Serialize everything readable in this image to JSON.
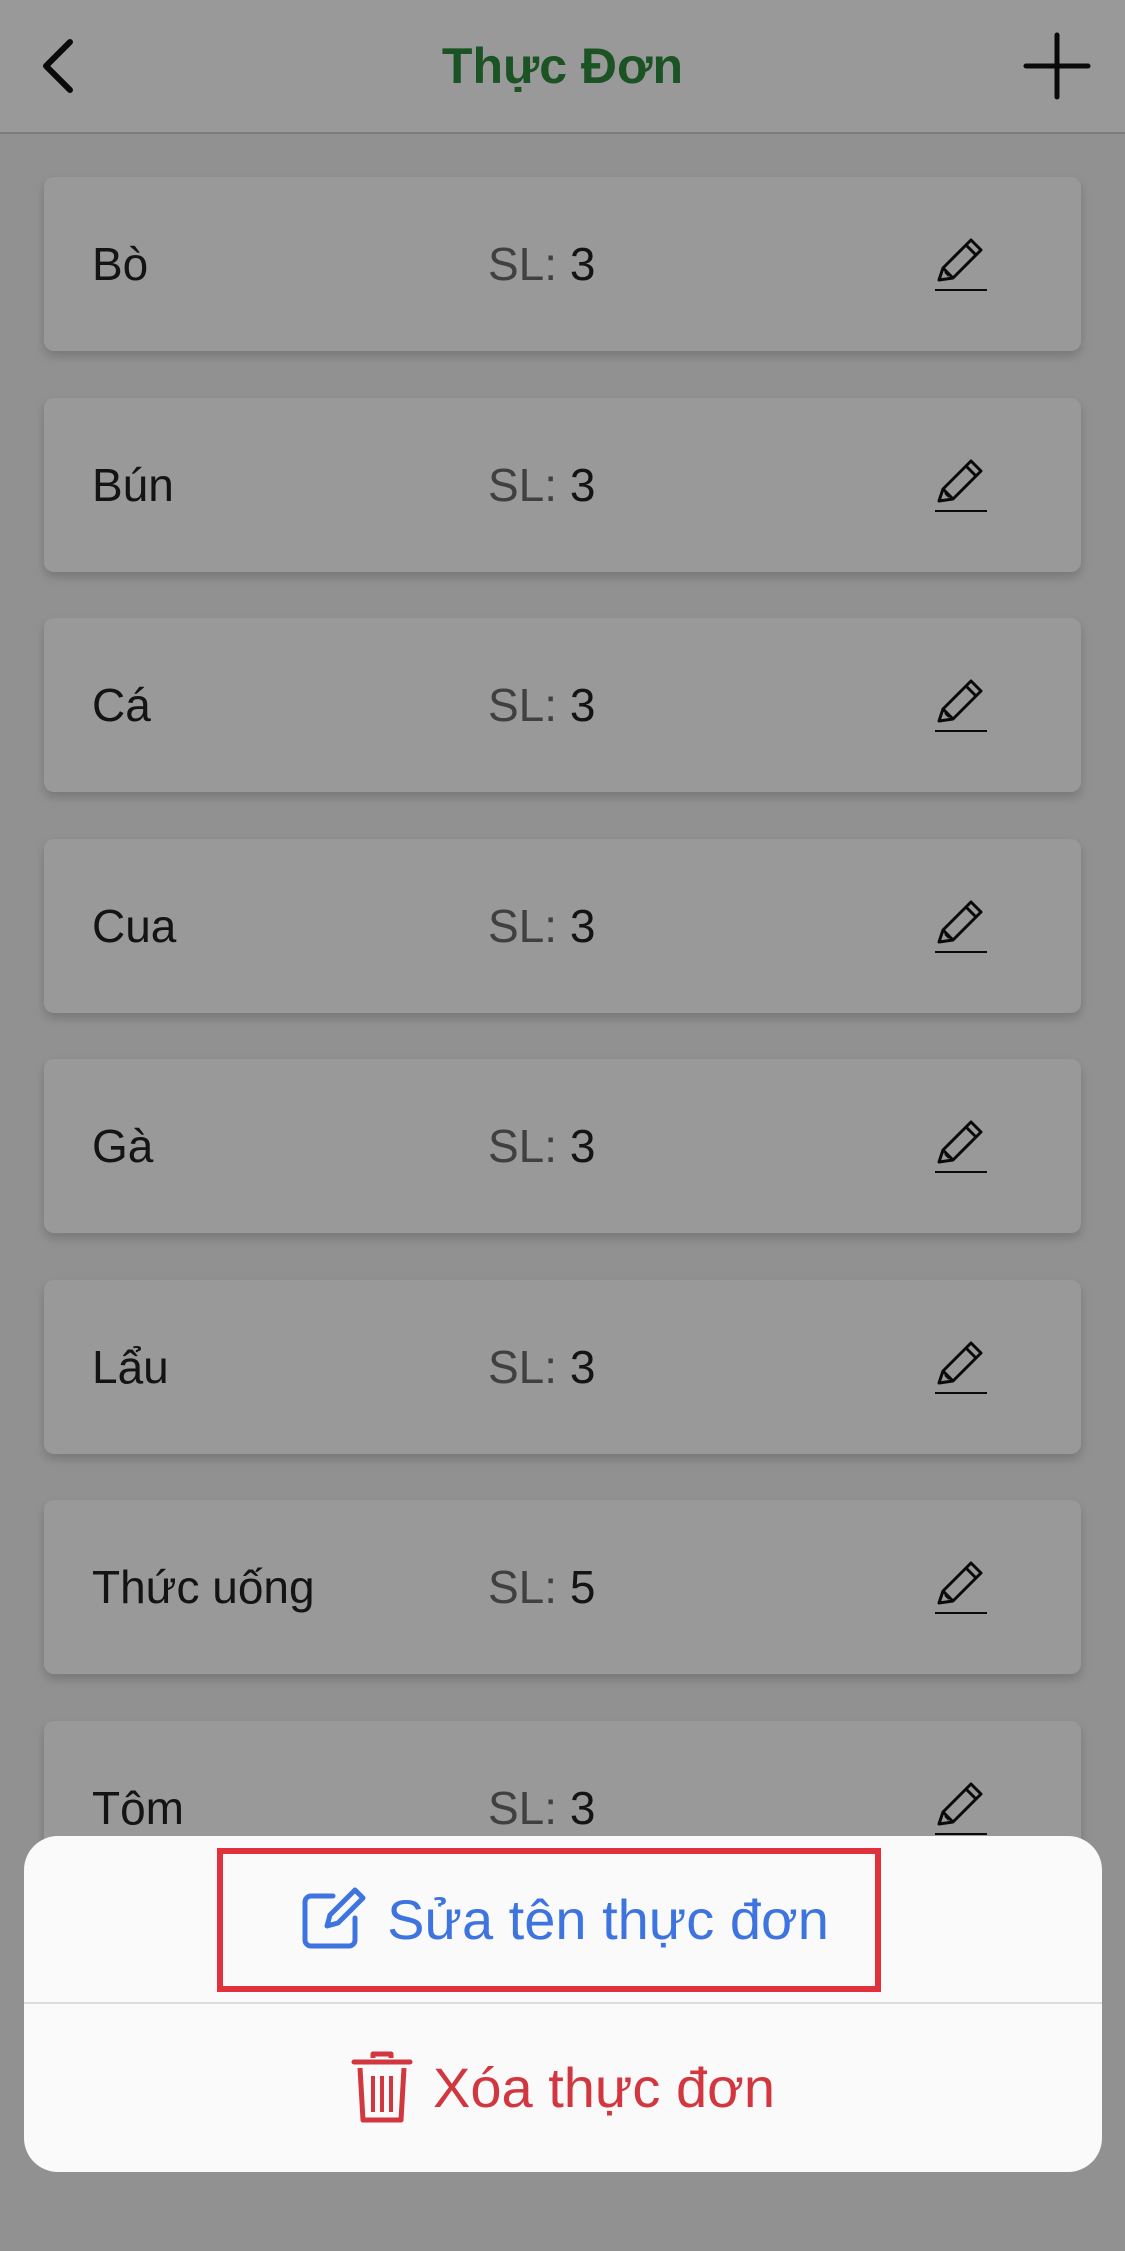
{
  "header": {
    "title": "Thực Đơn",
    "back_icon": "chevron-left-icon",
    "add_icon": "plus-icon",
    "title_color": "#2e8b3d"
  },
  "menu": {
    "items": [
      {
        "name": "Bò",
        "qty_label": "SL:",
        "qty": "3"
      },
      {
        "name": "Bún",
        "qty_label": "SL:",
        "qty": "3"
      },
      {
        "name": "Cá",
        "qty_label": "SL:",
        "qty": "3"
      },
      {
        "name": "Cua",
        "qty_label": "SL:",
        "qty": "3"
      },
      {
        "name": "Gà",
        "qty_label": "SL:",
        "qty": "3"
      },
      {
        "name": "Lẩu",
        "qty_label": "SL:",
        "qty": "3"
      },
      {
        "name": "Thức uống",
        "qty_label": "SL:",
        "qty": "5"
      },
      {
        "name": "Tôm",
        "qty_label": "SL:",
        "qty": "3"
      }
    ],
    "edit_icon": "pencil-icon"
  },
  "action_sheet": {
    "rename_label": "Sửa tên thực đơn",
    "rename_icon": "edit-square-icon",
    "rename_color": "#3d74e0",
    "delete_label": "Xóa thực đơn",
    "delete_icon": "trash-icon",
    "delete_color": "#d2363f"
  },
  "highlight_color": "#e0313d"
}
